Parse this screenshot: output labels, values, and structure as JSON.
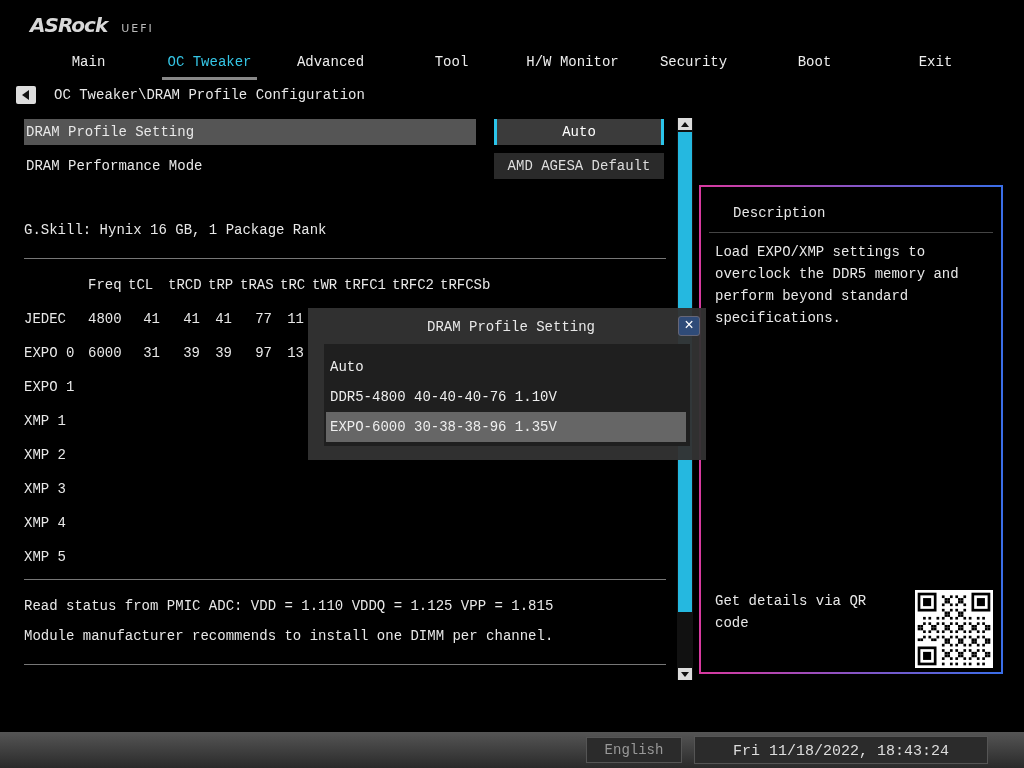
{
  "brand": {
    "logo": "ASRock",
    "suffix": "UEFI"
  },
  "tabs": [
    {
      "label": "Main",
      "selected": false
    },
    {
      "label": "OC Tweaker",
      "selected": true
    },
    {
      "label": "Advanced",
      "selected": false
    },
    {
      "label": "Tool",
      "selected": false
    },
    {
      "label": "H/W Monitor",
      "selected": false
    },
    {
      "label": "Security",
      "selected": false
    },
    {
      "label": "Boot",
      "selected": false
    },
    {
      "label": "Exit",
      "selected": false
    }
  ],
  "breadcrumb": "OC Tweaker\\DRAM Profile Configuration",
  "settings": [
    {
      "label": "DRAM Profile Setting",
      "value": "Auto",
      "selected": true
    },
    {
      "label": "DRAM Performance Mode",
      "value": "AMD AGESA Default",
      "selected": false
    }
  ],
  "module_info": "G.Skill: Hynix 16 GB, 1 Package Rank",
  "timing_table": {
    "columns": [
      "Freq",
      "tCL",
      "tRCD",
      "tRP",
      "tRAS",
      "tRC",
      "tWR",
      "tRFC1",
      "tRFC2",
      "tRFCSb"
    ],
    "rows": [
      {
        "profile": "JEDEC",
        "values": [
          "4800",
          "41",
          "41",
          "41",
          "77",
          "11"
        ]
      },
      {
        "profile": "EXPO 0",
        "values": [
          "6000",
          "31",
          "39",
          "39",
          "97",
          "13"
        ]
      },
      {
        "profile": "EXPO 1",
        "values": []
      },
      {
        "profile": "XMP 1",
        "values": []
      },
      {
        "profile": "XMP 2",
        "values": []
      },
      {
        "profile": "XMP 3",
        "values": []
      },
      {
        "profile": "XMP 4",
        "values": []
      },
      {
        "profile": "XMP 5",
        "values": []
      }
    ]
  },
  "status_lines": [
    "Read status from PMIC ADC: VDD = 1.110 VDDQ = 1.125 VPP = 1.815",
    "Module manufacturer recommends to install one DIMM per channel."
  ],
  "description": {
    "title": "Description",
    "text": "Load EXPO/XMP settings to overclock the DDR5 memory and perform beyond standard specifications.",
    "qr_caption": "Get details via QR code"
  },
  "dialog": {
    "title": "DRAM Profile Setting",
    "close": "×",
    "options": [
      {
        "label": "Auto",
        "selected": false
      },
      {
        "label": "DDR5-4800 40-40-40-76 1.10V",
        "selected": false
      },
      {
        "label": "EXPO-6000 30-38-38-96 1.35V",
        "selected": true
      }
    ]
  },
  "status_bar": {
    "language": "English",
    "datetime": "Fri 11/18/2022, 18:43:24"
  }
}
